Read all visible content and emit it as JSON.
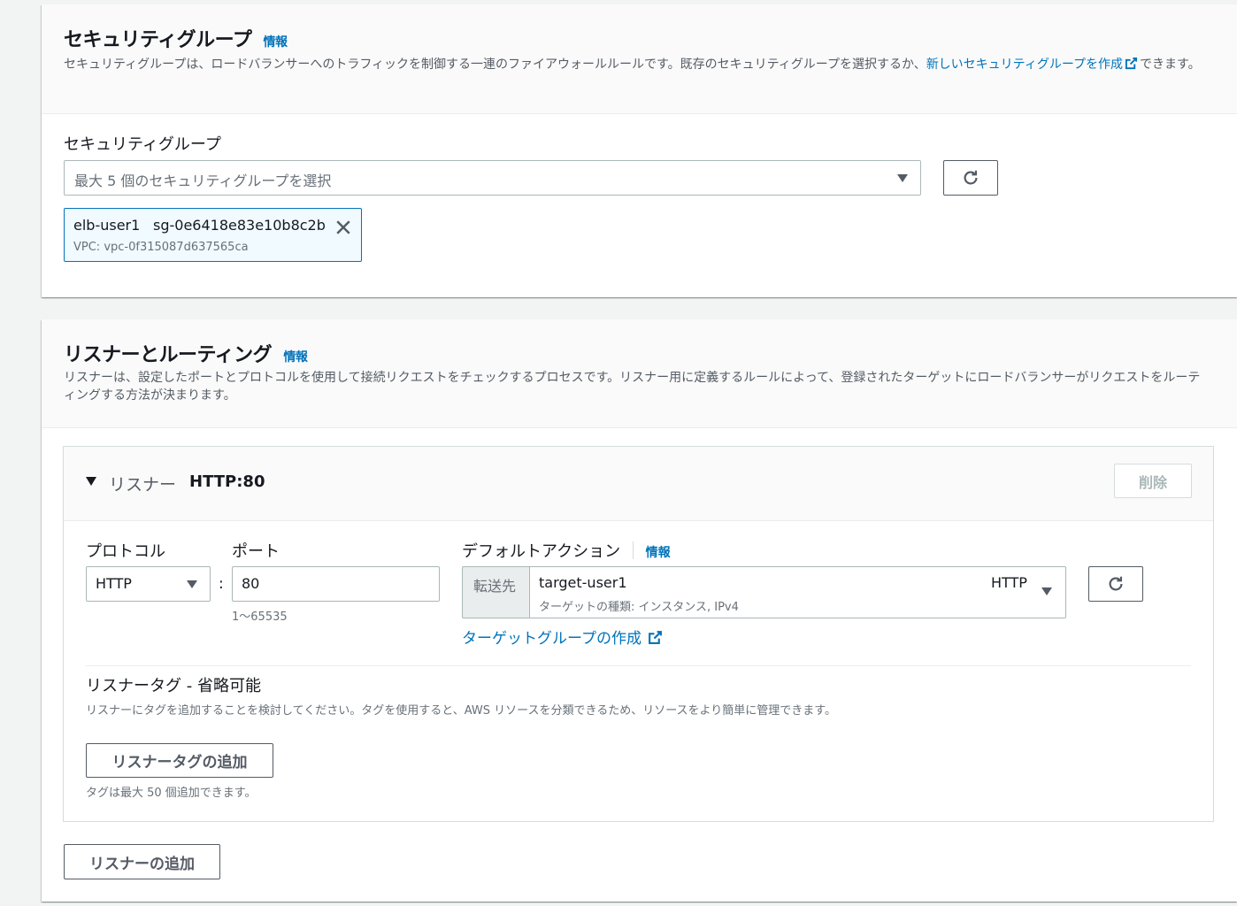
{
  "security": {
    "title": "セキュリティグループ",
    "info": "情報",
    "description_prefix": "セキュリティグループは、ロードバランサーへのトラフィックを制御する一連のファイアウォールルールです。既存のセキュリティグループを選択するか、",
    "description_link": "新しいセキュリティグループを作成",
    "description_suffix": "できます。",
    "field_label": "セキュリティグループ",
    "select_placeholder": "最大 5 個のセキュリティグループを選択",
    "token": {
      "name": "elb-user1",
      "id": "sg-0e6418e83e10b8c2b",
      "vpc": "VPC: vpc-0f315087d637565ca"
    }
  },
  "listeners": {
    "title": "リスナーとルーティング",
    "info": "情報",
    "description": "リスナーは、設定したポートとプロトコルを使用して接続リクエストをチェックするプロセスです。リスナー用に定義するルールによって、登録されたターゲットにロードバランサーがリクエストをルーティングする方法が決まります。",
    "listener": {
      "label": "リスナー",
      "name": "HTTP:80",
      "remove_button": "削除",
      "protocol_label": "プロトコル",
      "protocol_value": "HTTP",
      "colon": ":",
      "port_label": "ポート",
      "port_value": "80",
      "port_hint": "1〜65535",
      "action_label": "デフォルトアクション",
      "action_info": "情報",
      "forward_label": "転送先",
      "target_name": "target-user1",
      "target_protocol": "HTTP",
      "target_detail": "ターゲットの種類: インスタンス, IPv4",
      "create_target_link": "ターゲットグループの作成",
      "tags_title": "リスナータグ - 省略可能",
      "tags_desc": "リスナーにタグを追加することを検討してください。タグを使用すると、AWS リソースを分類できるため、リソースをより簡単に管理できます。",
      "add_tag_button": "リスナータグの追加",
      "tags_limit": "タグは最大 50 個追加できます。"
    },
    "add_listener_button": "リスナーの追加"
  }
}
